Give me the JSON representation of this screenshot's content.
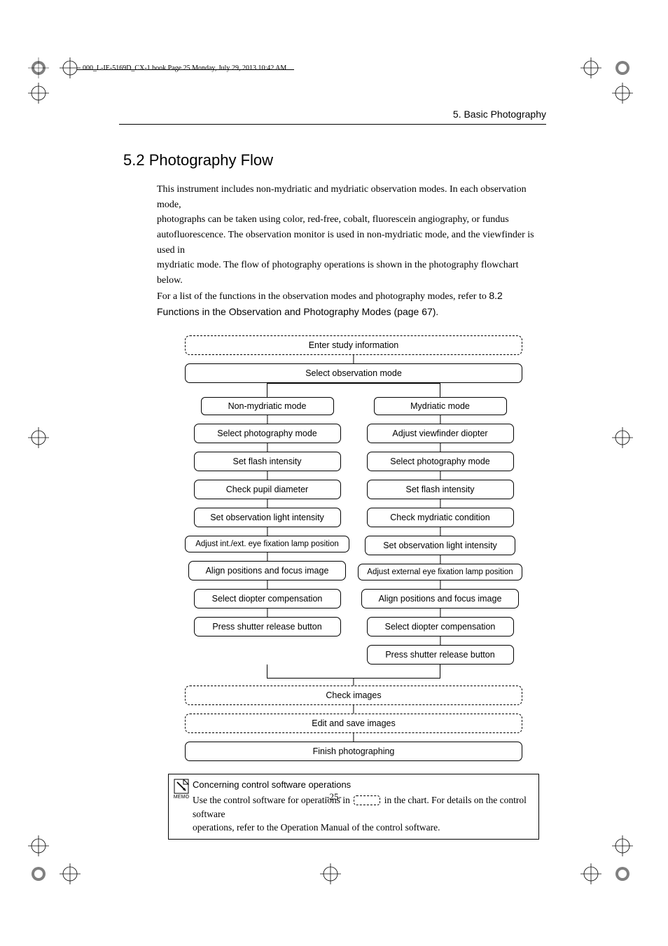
{
  "header_footer_text": "000_L-IE-5169D_CX-1.book  Page 25  Monday, July 29, 2013  10:42 AM",
  "chapter_label": "5. Basic Photography",
  "section_title": "5.2 Photography Flow",
  "paragraph": {
    "line1": "This instrument includes non-mydriatic and mydriatic observation modes. In each observation mode,",
    "line2": "photographs can be taken using color, red-free, cobalt, fluorescein angiography, or fundus",
    "line3": "autofluorescence. The observation monitor is used in non-mydriatic mode, and the viewfinder is used in",
    "line4": "mydriatic mode. The flow of photography operations is shown in the photography flowchart below.",
    "line5a": "For a list of the functions in the observation modes and photography modes, refer to ",
    "line5b_sans": "8.2 Functions in the Observation and Photography Modes (page 67)",
    "line5c": "."
  },
  "flow": {
    "enter_study": "Enter study information",
    "select_obs": "Select observation mode",
    "left_head": "Non-mydriatic mode",
    "right_head": "Mydriatic mode",
    "left": {
      "s1": "Select photography mode",
      "s2": "Set flash intensity",
      "s3": "Check pupil diameter",
      "s4": "Set observation light intensity",
      "s5": "Adjust int./ext. eye fixation lamp position",
      "s6": "Align positions and focus image",
      "s7": "Select diopter compensation",
      "s8": "Press shutter release button"
    },
    "right": {
      "s1": "Adjust viewfinder diopter",
      "s2": "Select photography mode",
      "s3": "Set flash intensity",
      "s4": "Check mydriatic condition",
      "s5": "Set observation light intensity",
      "s6": "Adjust external eye fixation lamp position",
      "s7": "Align positions and focus image",
      "s8": "Select diopter compensation",
      "s9": "Press shutter release button"
    },
    "check_images": "Check images",
    "edit_save": "Edit and save images",
    "finish": "Finish photographing"
  },
  "memo": {
    "icon_label": "MEMO",
    "title": "Concerning control software operations",
    "text_a": "Use the control software for operations in ",
    "text_b": " in the chart. For details on the control software",
    "text_c": "operations, refer to the Operation Manual of the control software."
  },
  "page_number": "-25-"
}
